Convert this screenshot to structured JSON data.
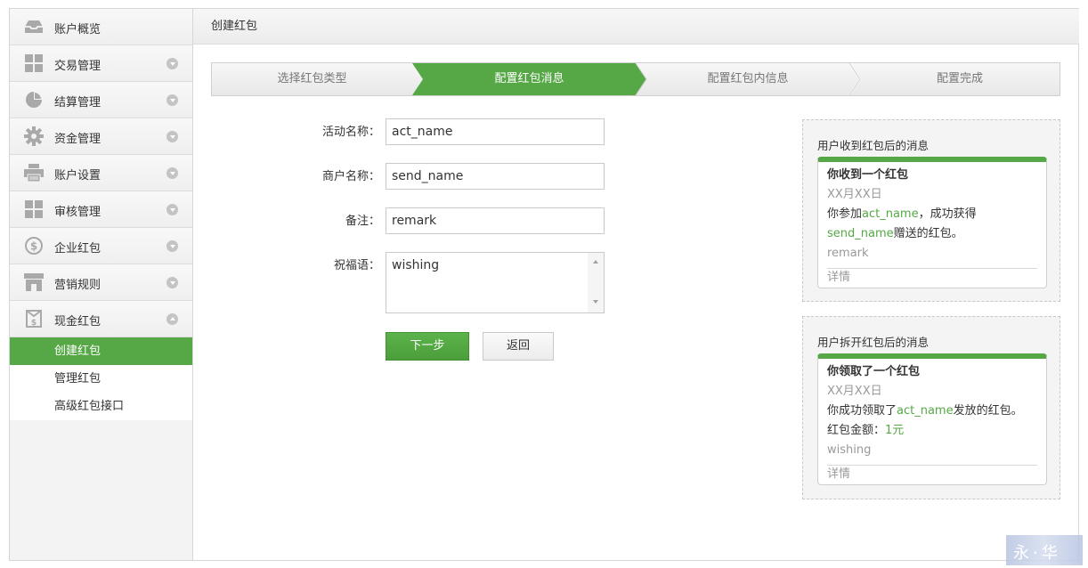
{
  "sidebar": {
    "items": [
      {
        "label": "账户概览",
        "icon": "inbox-icon",
        "arrow": "none"
      },
      {
        "label": "交易管理",
        "icon": "grid-icon",
        "arrow": "down"
      },
      {
        "label": "结算管理",
        "icon": "pie-chart-icon",
        "arrow": "down"
      },
      {
        "label": "资金管理",
        "icon": "gear-icon",
        "arrow": "down"
      },
      {
        "label": "账户设置",
        "icon": "printer-icon",
        "arrow": "down"
      },
      {
        "label": "审核管理",
        "icon": "grid-icon",
        "arrow": "down"
      },
      {
        "label": "企业红包",
        "icon": "dollar-coin-icon",
        "arrow": "down"
      },
      {
        "label": "营销规则",
        "icon": "store-icon",
        "arrow": "down"
      },
      {
        "label": "现金红包",
        "icon": "money-bag-icon",
        "arrow": "up"
      }
    ],
    "sub_items": [
      {
        "label": "创建红包",
        "active": true
      },
      {
        "label": "管理红包",
        "active": false
      },
      {
        "label": "高级红包接口",
        "active": false
      }
    ]
  },
  "header": {
    "title": "创建红包"
  },
  "steps": [
    {
      "label": "选择红包类型",
      "active": false
    },
    {
      "label": "配置红包消息",
      "active": true
    },
    {
      "label": "配置红包内信息",
      "active": false
    },
    {
      "label": "配置完成",
      "active": false
    }
  ],
  "form": {
    "act_name": {
      "label": "活动名称：",
      "value": "act_name"
    },
    "send_name": {
      "label": "商户名称：",
      "value": "send_name"
    },
    "remark": {
      "label": "备注：",
      "value": "remark"
    },
    "wishing": {
      "label": "祝福语：",
      "value": "wishing"
    },
    "next_label": "下一步",
    "back_label": "返回"
  },
  "preview_received": {
    "title": "用户收到红包后的消息",
    "card_title": "你收到一个红包",
    "date": "XX月XX日",
    "line1_prefix": "你参加",
    "line1_act": "act_name",
    "line1_suffix": "，成功获得",
    "line2_send": "send_name",
    "line2_suffix": "赠送的红包。",
    "remark": "remark",
    "detail": "详情"
  },
  "preview_opened": {
    "title": "用户拆开红包后的消息",
    "card_title": "你领取了一个红包",
    "date": "XX月XX日",
    "line1_prefix": "你成功领取了",
    "line1_act": "act_name",
    "line1_suffix": "发放的红包。",
    "amount_label": "红包金额：",
    "amount_value": "1元",
    "wishing": "wishing",
    "detail": "详情"
  },
  "colors": {
    "accent": "#55a845",
    "muted": "#999999"
  }
}
